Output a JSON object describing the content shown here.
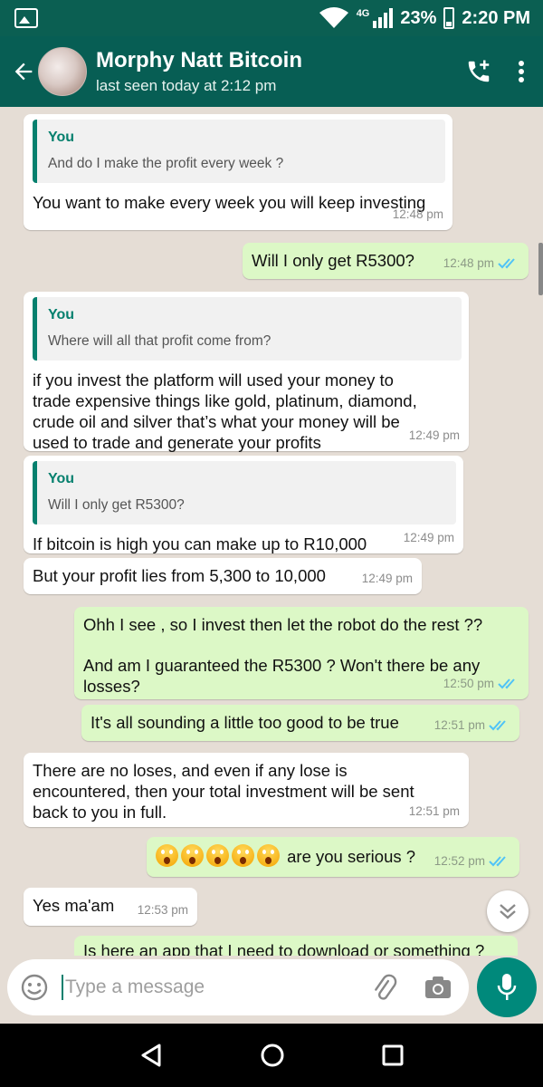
{
  "status_bar": {
    "network": "4G",
    "battery": "23%",
    "time": "2:20 PM"
  },
  "header": {
    "contact_name": "Morphy Natt Bitcoin",
    "last_seen": "last seen today at 2:12 pm"
  },
  "messages": [
    {
      "direction": "in",
      "quote_author": "You",
      "quote_text": "And do I make the profit every week ?",
      "text": "You want to make every week you will keep investing",
      "time": "12:48 pm"
    },
    {
      "direction": "out",
      "text": "Will I only get R5300?",
      "time": "12:48 pm",
      "read": true
    },
    {
      "direction": "in",
      "quote_author": "You",
      "quote_text": "Where will all that profit come from?",
      "text": "if you invest the platform will used your money to trade expensive things like gold, platinum, diamond, crude oil and silver that’s what your money will be used to trade and generate your profits",
      "time": "12:49 pm"
    },
    {
      "direction": "in",
      "quote_author": "You",
      "quote_text": "Will I only get R5300?",
      "text": "If bitcoin is high you can make up to R10,000",
      "time": "12:49 pm"
    },
    {
      "direction": "in",
      "text": "But your profit lies from 5,300 to 10,000",
      "time": "12:49 pm"
    },
    {
      "direction": "out",
      "text_line1": "Ohh I see , so I invest then let the robot do the rest ??",
      "text_line2": "And am I guaranteed the R5300 ? Won't there be any losses?",
      "time": "12:50 pm",
      "read": true
    },
    {
      "direction": "out",
      "text": "It's all sounding a little too good to be true",
      "time": "12:51 pm",
      "read": true
    },
    {
      "direction": "in",
      "text": "There are no loses, and even if any lose is encountered, then your total investment will be sent back to you in full.",
      "time": "12:51 pm"
    },
    {
      "direction": "out",
      "emoji": "face-screaming-in-fear x5",
      "text": "are you serious ?",
      "time": "12:52 pm",
      "read": true
    },
    {
      "direction": "in",
      "text": "Yes ma'am",
      "time": "12:53 pm"
    },
    {
      "direction": "out",
      "text": "Is here an app that I need to download or something ?",
      "partial": true
    }
  ],
  "input": {
    "placeholder": "Type a message"
  },
  "colors": {
    "header": "#075e54",
    "status_bar": "#0b5f52",
    "accent": "#00897b",
    "outgoing_bubble": "#dcf8c6",
    "chat_bg": "#e5ddd5",
    "read_ticks": "#4fc3f7"
  },
  "icons": [
    "back-arrow-icon",
    "add-call-icon",
    "more-vert-icon",
    "emoji-icon",
    "attach-icon",
    "camera-icon",
    "mic-icon",
    "scroll-down-icon",
    "nav-back-icon",
    "nav-home-icon",
    "nav-recents-icon"
  ]
}
